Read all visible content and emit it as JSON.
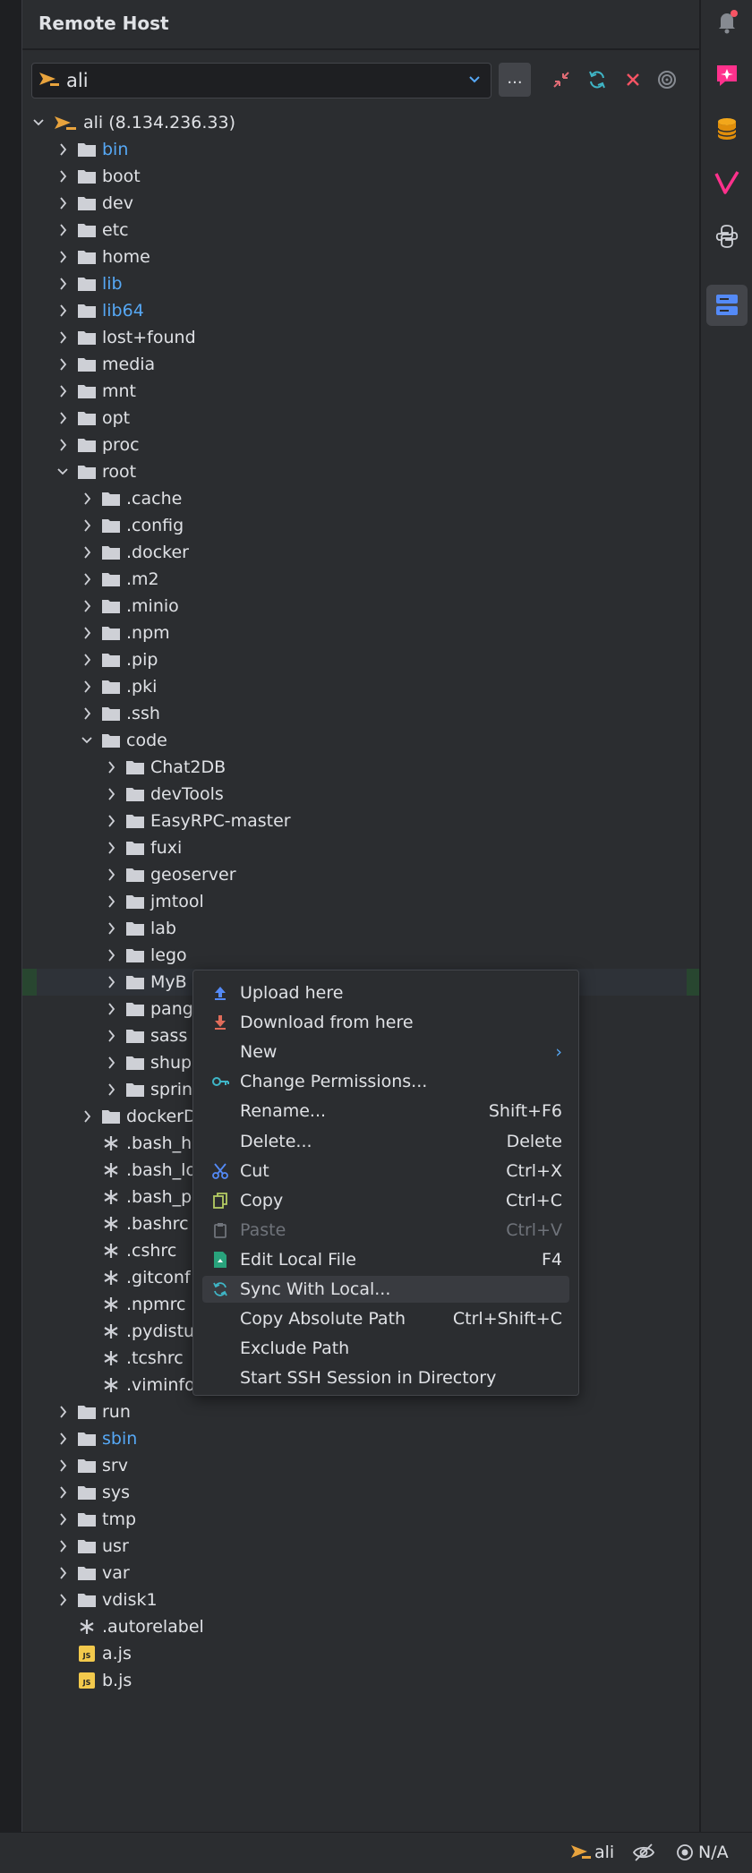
{
  "panel": {
    "title": "Remote Host",
    "host_selected": "ali",
    "more_label": "..."
  },
  "tree": [
    {
      "name": "ali (8.134.236.33)",
      "type": "host",
      "depth": 0,
      "expanded": true
    },
    {
      "name": "bin",
      "type": "folder",
      "depth": 1,
      "link": true
    },
    {
      "name": "boot",
      "type": "folder",
      "depth": 1
    },
    {
      "name": "dev",
      "type": "folder",
      "depth": 1
    },
    {
      "name": "etc",
      "type": "folder",
      "depth": 1
    },
    {
      "name": "home",
      "type": "folder",
      "depth": 1
    },
    {
      "name": "lib",
      "type": "folder",
      "depth": 1,
      "link": true
    },
    {
      "name": "lib64",
      "type": "folder",
      "depth": 1,
      "link": true
    },
    {
      "name": "lost+found",
      "type": "folder",
      "depth": 1
    },
    {
      "name": "media",
      "type": "folder",
      "depth": 1
    },
    {
      "name": "mnt",
      "type": "folder",
      "depth": 1
    },
    {
      "name": "opt",
      "type": "folder",
      "depth": 1
    },
    {
      "name": "proc",
      "type": "folder",
      "depth": 1
    },
    {
      "name": "root",
      "type": "folder",
      "depth": 1,
      "expanded": true
    },
    {
      "name": ".cache",
      "type": "folder",
      "depth": 2
    },
    {
      "name": ".config",
      "type": "folder",
      "depth": 2
    },
    {
      "name": ".docker",
      "type": "folder",
      "depth": 2
    },
    {
      "name": ".m2",
      "type": "folder",
      "depth": 2
    },
    {
      "name": ".minio",
      "type": "folder",
      "depth": 2
    },
    {
      "name": ".npm",
      "type": "folder",
      "depth": 2
    },
    {
      "name": ".pip",
      "type": "folder",
      "depth": 2
    },
    {
      "name": ".pki",
      "type": "folder",
      "depth": 2
    },
    {
      "name": ".ssh",
      "type": "folder",
      "depth": 2
    },
    {
      "name": "code",
      "type": "folder",
      "depth": 2,
      "expanded": true
    },
    {
      "name": "Chat2DB",
      "type": "folder",
      "depth": 3
    },
    {
      "name": "devTools",
      "type": "folder",
      "depth": 3
    },
    {
      "name": "EasyRPC-master",
      "type": "folder",
      "depth": 3
    },
    {
      "name": "fuxi",
      "type": "folder",
      "depth": 3
    },
    {
      "name": "geoserver",
      "type": "folder",
      "depth": 3
    },
    {
      "name": "jmtool",
      "type": "folder",
      "depth": 3
    },
    {
      "name": "lab",
      "type": "folder",
      "depth": 3
    },
    {
      "name": "lego",
      "type": "folder",
      "depth": 3
    },
    {
      "name": "MyB",
      "type": "folder",
      "depth": 3,
      "selected": true
    },
    {
      "name": "pang",
      "type": "folder",
      "depth": 3
    },
    {
      "name": "sass",
      "type": "folder",
      "depth": 3
    },
    {
      "name": "shup",
      "type": "folder",
      "depth": 3
    },
    {
      "name": "sprin",
      "type": "folder",
      "depth": 3
    },
    {
      "name": "dockerD",
      "type": "folder",
      "depth": 2
    },
    {
      "name": ".bash_h",
      "type": "file",
      "depth": 2
    },
    {
      "name": ".bash_lo",
      "type": "file",
      "depth": 2
    },
    {
      "name": ".bash_p",
      "type": "file",
      "depth": 2
    },
    {
      "name": ".bashrc",
      "type": "file",
      "depth": 2
    },
    {
      "name": ".cshrc",
      "type": "file",
      "depth": 2
    },
    {
      "name": ".gitconf",
      "type": "file",
      "depth": 2
    },
    {
      "name": ".npmrc",
      "type": "file",
      "depth": 2
    },
    {
      "name": ".pydistu",
      "type": "file",
      "depth": 2
    },
    {
      "name": ".tcshrc",
      "type": "file",
      "depth": 2
    },
    {
      "name": ".viminfo",
      "type": "file",
      "depth": 2
    },
    {
      "name": "run",
      "type": "folder",
      "depth": 1
    },
    {
      "name": "sbin",
      "type": "folder",
      "depth": 1,
      "link": true
    },
    {
      "name": "srv",
      "type": "folder",
      "depth": 1
    },
    {
      "name": "sys",
      "type": "folder",
      "depth": 1
    },
    {
      "name": "tmp",
      "type": "folder",
      "depth": 1
    },
    {
      "name": "usr",
      "type": "folder",
      "depth": 1
    },
    {
      "name": "var",
      "type": "folder",
      "depth": 1
    },
    {
      "name": "vdisk1",
      "type": "folder",
      "depth": 1
    },
    {
      "name": ".autorelabel",
      "type": "file",
      "depth": 1
    },
    {
      "name": "a.js",
      "type": "js",
      "depth": 1
    },
    {
      "name": "b.js",
      "type": "js",
      "depth": 1
    }
  ],
  "context_menu": [
    {
      "label": "Upload here",
      "icon": "upload-icon",
      "shortcut": ""
    },
    {
      "label": "Download from here",
      "icon": "download-icon",
      "shortcut": ""
    },
    {
      "label": "New",
      "icon": "",
      "shortcut": "›",
      "submenu": true
    },
    {
      "label": "Change Permissions...",
      "icon": "key-icon",
      "shortcut": ""
    },
    {
      "label": "Rename...",
      "icon": "",
      "shortcut": "Shift+F6"
    },
    {
      "label": "Delete...",
      "icon": "",
      "shortcut": "Delete"
    },
    {
      "label": "Cut",
      "icon": "scissors-icon",
      "shortcut": "Ctrl+X"
    },
    {
      "label": "Copy",
      "icon": "copy-icon",
      "shortcut": "Ctrl+C"
    },
    {
      "label": "Paste",
      "icon": "paste-icon",
      "shortcut": "Ctrl+V",
      "disabled": true
    },
    {
      "label": "Edit Local File",
      "icon": "edit-file-icon",
      "shortcut": "F4"
    },
    {
      "label": "Sync With Local...",
      "icon": "sync-icon",
      "shortcut": "",
      "hover": true
    },
    {
      "label": "Copy Absolute Path",
      "icon": "",
      "shortcut": "Ctrl+Shift+C"
    },
    {
      "label": "Exclude Path",
      "icon": "",
      "shortcut": ""
    },
    {
      "label": "Start SSH Session in Directory",
      "icon": "",
      "shortcut": ""
    }
  ],
  "status_bar": {
    "host": "ali",
    "availability": "N/A"
  },
  "colors": {
    "accent_blue": "#56a8f5",
    "folder": "#ced0d6",
    "ssh_orange": "#e8a33d",
    "close_red": "#f75464",
    "sync_teal": "#3fb6c7"
  }
}
